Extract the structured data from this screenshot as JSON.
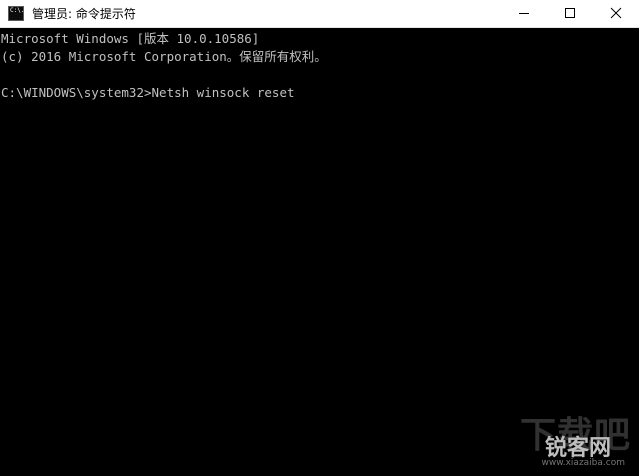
{
  "window": {
    "title": "管理员: 命令提示符",
    "icon_label": "C:\\.",
    "icon": "cmd-icon",
    "controls": {
      "minimize": "minimize-icon",
      "maximize": "maximize-icon",
      "close": "close-icon"
    }
  },
  "console": {
    "lines": [
      "Microsoft Windows [版本 10.0.10586]",
      "(c) 2016 Microsoft Corporation。保留所有权利。",
      "C:\\WINDOWS\\system32>Netsh winsock reset"
    ],
    "text_color": "#c0c0c0",
    "background": "#000000"
  },
  "watermark": {
    "big": "下载吧",
    "mid": "锐客网",
    "url": "www.xiazaiba.com"
  }
}
